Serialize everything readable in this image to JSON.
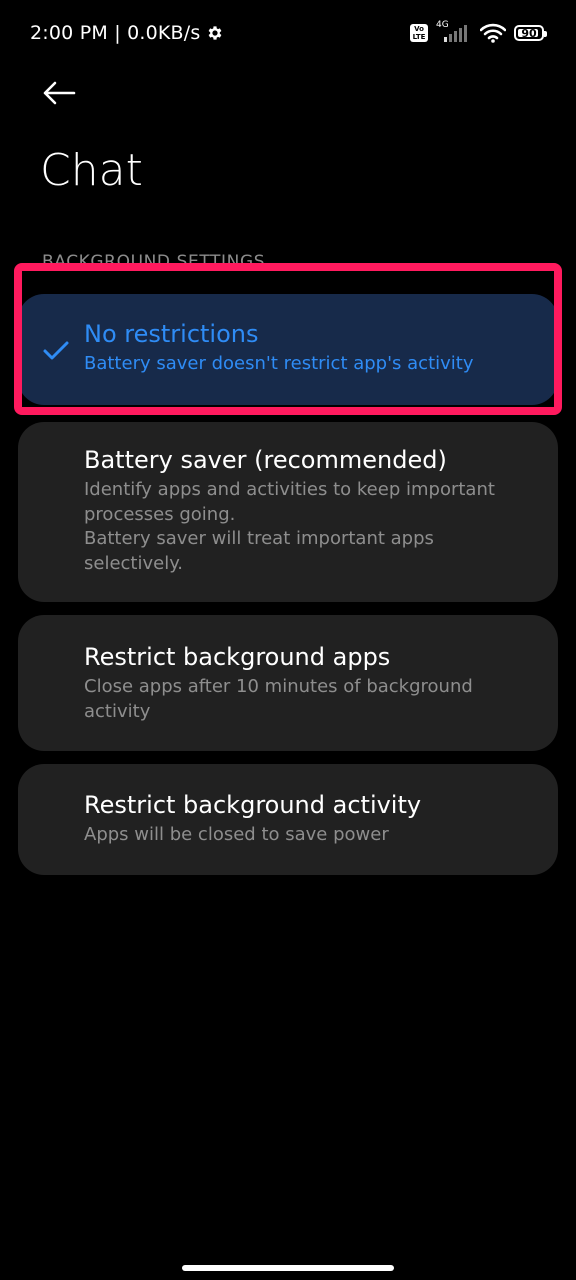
{
  "status_bar": {
    "time": "2:00 PM",
    "separator": " | ",
    "net_speed": "0.0KB/s",
    "settings_icon": "gear-icon",
    "volte_line1": "Vo",
    "volte_line2": "LTE",
    "network_type": "4G",
    "signal_icon": "signal-icon",
    "wifi_icon": "wifi-icon",
    "battery_level": "90",
    "battery_fraction": 0.9
  },
  "header": {
    "back_icon": "arrow-left-icon",
    "title": "Chat"
  },
  "section": {
    "label": "BACKGROUND SETTINGS"
  },
  "options": [
    {
      "title": "No restrictions",
      "description": "Battery saver doesn't restrict app's activity",
      "selected": true
    },
    {
      "title": "Battery saver (recommended)",
      "description": "Identify apps and activities to keep important\nprocesses going.\nBattery saver will treat important apps\nselectively.",
      "selected": false
    },
    {
      "title": "Restrict background apps",
      "description": "Close apps after 10 minutes of background\nactivity",
      "selected": false
    },
    {
      "title": "Restrict background activity",
      "description": "Apps will be closed to save power",
      "selected": false
    }
  ],
  "colors": {
    "background": "#000000",
    "card": "#212121",
    "selected_card": "#172a4a",
    "accent": "#2f8cf5",
    "highlight": "#ff1a5e"
  }
}
